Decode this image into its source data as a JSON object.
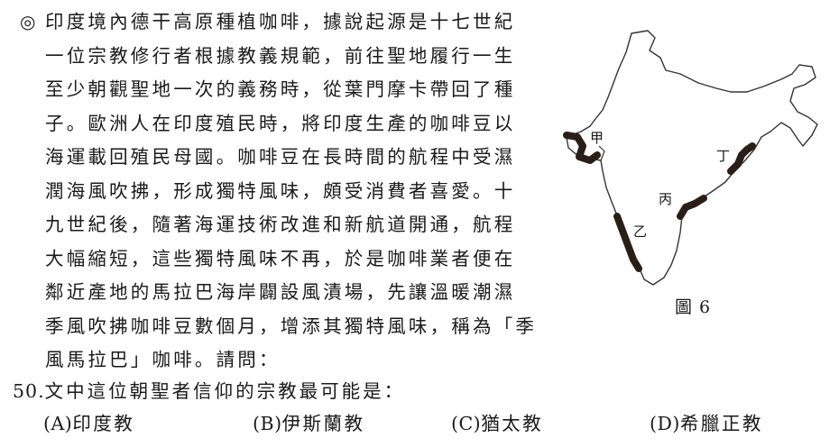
{
  "passage": {
    "marker": "◎",
    "lines": [
      "印度境內德干高原種植咖啡，據說起源是十七世紀",
      "一位宗教修行者根據教義規範，前往聖地履行一生",
      "至少朝觀聖地一次的義務時，從葉門摩卡帶回了種",
      "子。歐洲人在印度殖民時，將印度生產的咖啡豆以",
      "海運載回殖民母國。咖啡豆在長時間的航程中受濕",
      "潤海風吹拂，形成獨特風味，頗受消費者喜愛。十",
      "九世紀後，隨著海運技術改進和新航道開通，航程",
      "大幅縮短，這些獨特風味不再，於是咖啡業者便在",
      "鄰近產地的馬拉巴海岸闢設風漬場，先讓溫暖潮濕",
      "季風吹拂咖啡豆數個月，增添其獨特風味，稱為「季",
      "風馬拉巴」咖啡。請問："
    ]
  },
  "figure": {
    "caption": "圖 6",
    "labels": {
      "jia": "甲",
      "yi": "乙",
      "bing": "丙",
      "ding": "丁"
    }
  },
  "question": {
    "number": "50.",
    "stem": "文中這位朝聖者信仰的宗教最可能是：",
    "options": [
      {
        "letter": "(A)",
        "text": "印度教"
      },
      {
        "letter": "(B)",
        "text": "伊斯蘭教"
      },
      {
        "letter": "(C)",
        "text": "猶太教"
      },
      {
        "letter": "(D)",
        "text": "希臘正教"
      }
    ]
  }
}
